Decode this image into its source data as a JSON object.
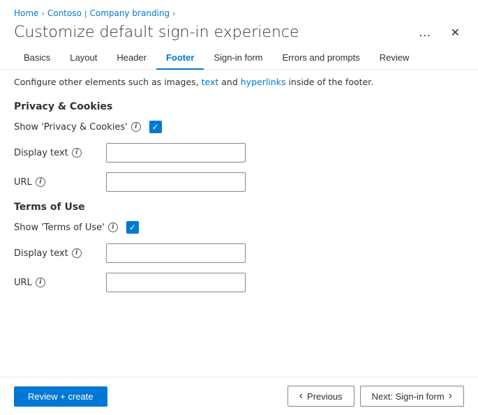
{
  "breadcrumb": {
    "items": [
      {
        "label": "Home",
        "href": "#"
      },
      {
        "sep": ">"
      },
      {
        "label": "Contoso",
        "href": "#"
      },
      {
        "sep": "|"
      },
      {
        "label": "Company branding",
        "href": "#"
      },
      {
        "sep": ">"
      }
    ]
  },
  "page": {
    "title": "Customize default sign-in experience",
    "ellipsis_label": "…",
    "close_label": "✕"
  },
  "tabs": [
    {
      "label": "Basics",
      "active": false
    },
    {
      "label": "Layout",
      "active": false
    },
    {
      "label": "Header",
      "active": false
    },
    {
      "label": "Footer",
      "active": true
    },
    {
      "label": "Sign-in form",
      "active": false
    },
    {
      "label": "Errors and prompts",
      "active": false
    },
    {
      "label": "Review",
      "active": false
    }
  ],
  "info_bar": {
    "text_before": "Configure other elements such as images, ",
    "link1": "text",
    "text_middle": " and ",
    "link2": "hyperlinks",
    "text_after": " inside of the footer."
  },
  "sections": [
    {
      "id": "privacy-cookies",
      "title": "Privacy & Cookies",
      "show_label": "Show 'Privacy & Cookies'",
      "show_checked": true,
      "display_text_label": "Display text",
      "display_text_value": "",
      "url_label": "URL",
      "url_value": ""
    },
    {
      "id": "terms-of-use",
      "title": "Terms of Use",
      "show_label": "Show 'Terms of Use'",
      "show_checked": true,
      "display_text_label": "Display text",
      "display_text_value": "",
      "url_label": "URL",
      "url_value": ""
    }
  ],
  "footer": {
    "review_create_label": "Review + create",
    "previous_label": "Previous",
    "next_label": "Next: Sign-in form"
  }
}
